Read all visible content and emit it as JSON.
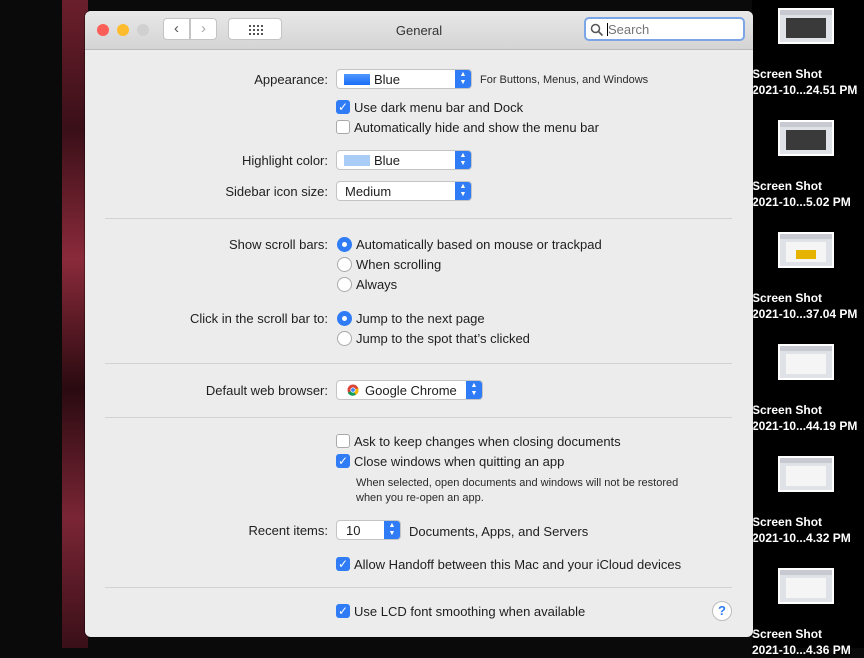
{
  "window": {
    "title": "General"
  },
  "search": {
    "placeholder": "Search"
  },
  "appearance": {
    "label": "Appearance:",
    "value": "Blue",
    "hint": "For Buttons, Menus, and Windows",
    "swatch_color": "#1a6ef5"
  },
  "dark_menu": {
    "label": "Use dark menu bar and Dock",
    "checked": true
  },
  "autohide_menu": {
    "label": "Automatically hide and show the menu bar",
    "checked": false
  },
  "highlight": {
    "label": "Highlight color:",
    "value": "Blue",
    "swatch_color": "#a9cdf7"
  },
  "sidebar_size": {
    "label": "Sidebar icon size:",
    "value": "Medium"
  },
  "scroll_bars": {
    "label": "Show scroll bars:",
    "options": [
      "Automatically based on mouse or trackpad",
      "When scrolling",
      "Always"
    ],
    "selected": 0
  },
  "click_scroll": {
    "label": "Click in the scroll bar to:",
    "options": [
      "Jump to the next page",
      "Jump to the spot that’s clicked"
    ],
    "selected": 0
  },
  "browser": {
    "label": "Default web browser:",
    "value": "Google Chrome",
    "icon": "chrome-icon"
  },
  "ask_keep": {
    "label": "Ask to keep changes when closing documents",
    "checked": false
  },
  "close_windows": {
    "label": "Close windows when quitting an app",
    "checked": true,
    "note_line1": "When selected, open documents and windows will not be restored",
    "note_line2": "when you re-open an app."
  },
  "recent": {
    "label": "Recent items:",
    "value": "10",
    "suffix": "Documents, Apps, and Servers"
  },
  "handoff": {
    "label": "Allow Handoff between this Mac and your iCloud devices",
    "checked": true
  },
  "lcd": {
    "label": "Use LCD font smoothing when available",
    "checked": true
  },
  "help": {
    "glyph": "?"
  },
  "desktop": {
    "items": [
      {
        "line1": "Screen Shot",
        "line2": "2021-10...24.51 PM"
      },
      {
        "line1": "Screen Shot",
        "line2": "2021-10...5.02 PM"
      },
      {
        "line1": "Screen Shot",
        "line2": "2021-10...37.04 PM"
      },
      {
        "line1": "Screen Shot",
        "line2": "2021-10...44.19 PM"
      },
      {
        "line1": "Screen Shot",
        "line2": "2021-10...4.32 PM"
      },
      {
        "line1": "Screen Shot",
        "line2": "2021-10...4.36 PM"
      }
    ]
  },
  "colors": {
    "accent": "#2f7cf6",
    "close": "#fc5f57",
    "minimize": "#fdbc2e",
    "zoom": "#d0d0d0"
  }
}
